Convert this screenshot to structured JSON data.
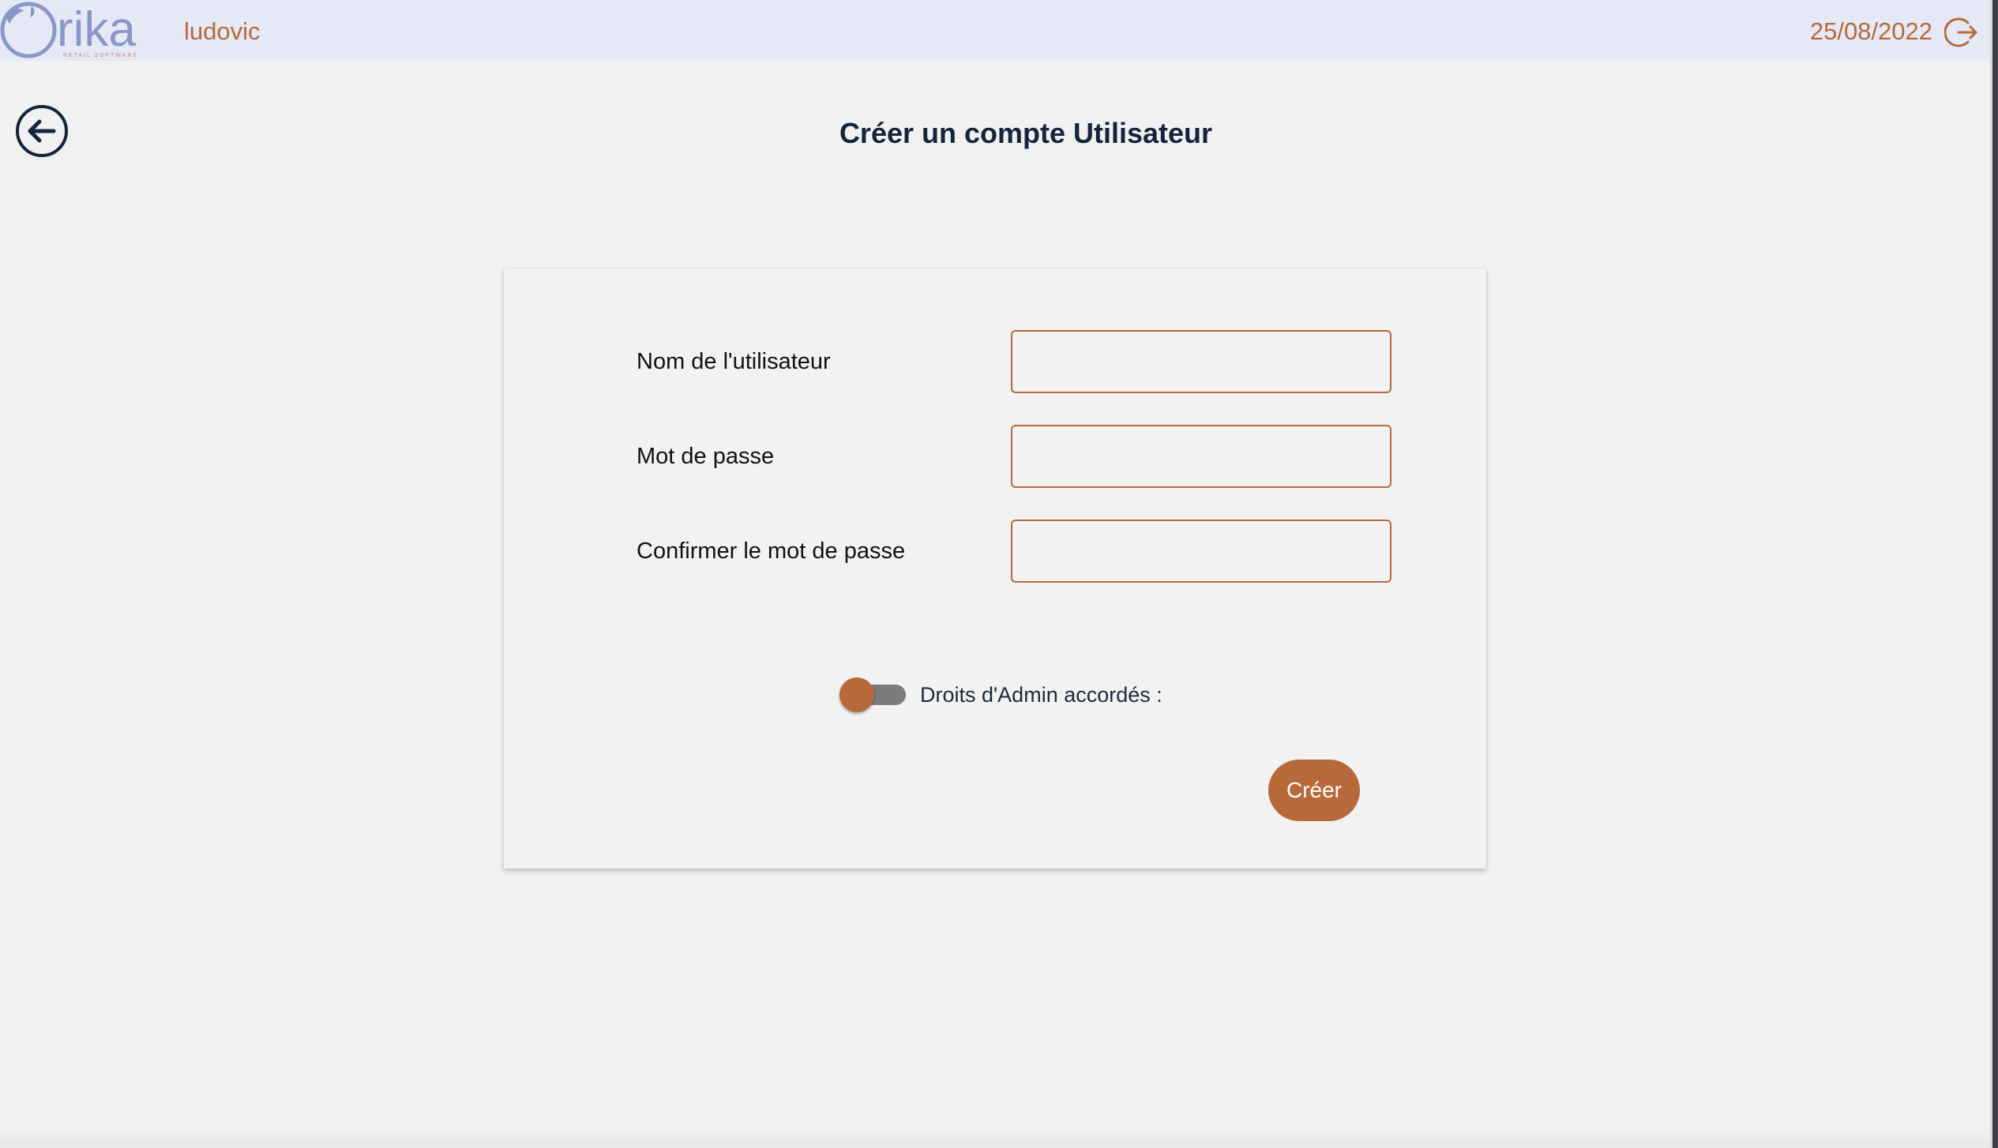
{
  "header": {
    "logo_text": "rika",
    "logo_tagline": "RETAIL SOFTWARE",
    "username": "ludovic",
    "date": "25/08/2022",
    "logout_icon": "logout-icon"
  },
  "page": {
    "back_icon": "arrow-left-circle-icon",
    "title": "Créer un compte Utilisateur"
  },
  "form": {
    "fields": [
      {
        "label": "Nom de l'utilisateur",
        "value": "",
        "type": "text"
      },
      {
        "label": "Mot de passe",
        "value": "",
        "type": "password"
      },
      {
        "label": "Confirmer le mot de passe",
        "value": "",
        "type": "password"
      }
    ],
    "admin_toggle": {
      "label": "Droits d'Admin accordés :",
      "checked": false
    },
    "submit_label": "Créer"
  },
  "colors": {
    "accent": "#b8693a",
    "header_bg": "#e5e9f6",
    "page_bg": "#f1f1f1",
    "title": "#14253b",
    "logo": "#8a98c8"
  }
}
